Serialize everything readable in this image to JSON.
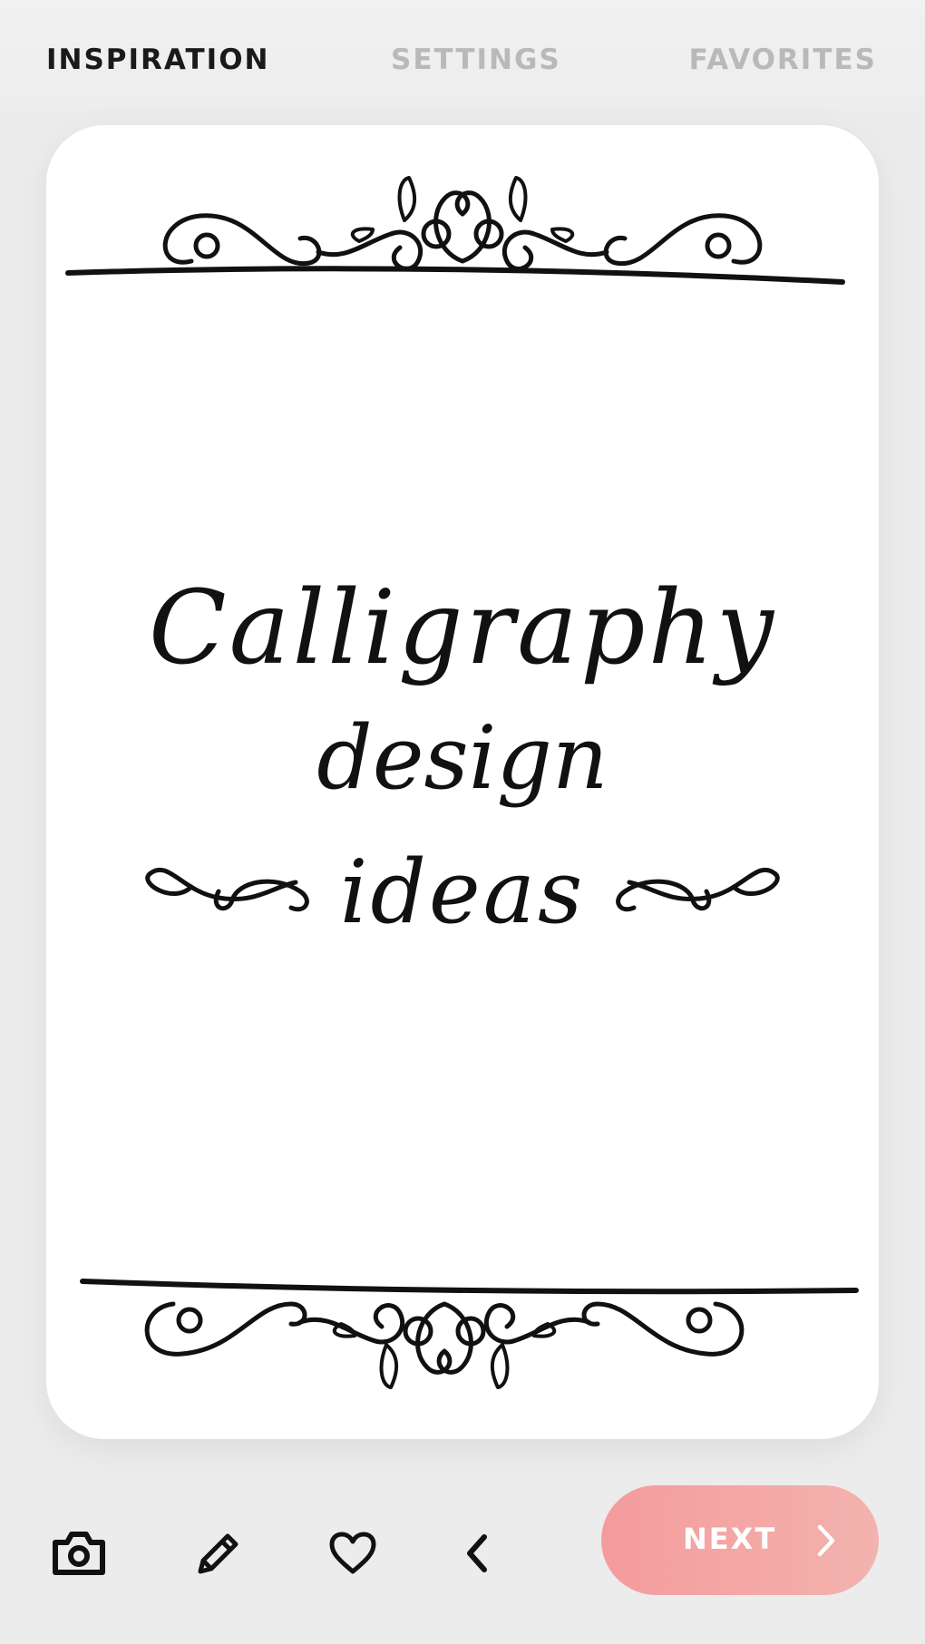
{
  "nav": {
    "tabs": [
      {
        "label": "INSPIRATION",
        "active": true
      },
      {
        "label": "SETTINGS",
        "active": false
      },
      {
        "label": "FAVORITES",
        "active": false
      }
    ]
  },
  "card": {
    "lines": [
      "Calligraphy",
      "design",
      "ideas"
    ]
  },
  "toolbar": {
    "icons": [
      "camera-icon",
      "pencil-icon",
      "heart-icon",
      "chevron-left-icon"
    ],
    "next_label": "NEXT",
    "next_icon": "chevron-right-icon"
  },
  "colors": {
    "active_tab": "#1a1a1a",
    "inactive_tab": "#b9b9b9",
    "next_gradient_start": "#f49b9d",
    "next_gradient_end": "#f3b3ae"
  }
}
